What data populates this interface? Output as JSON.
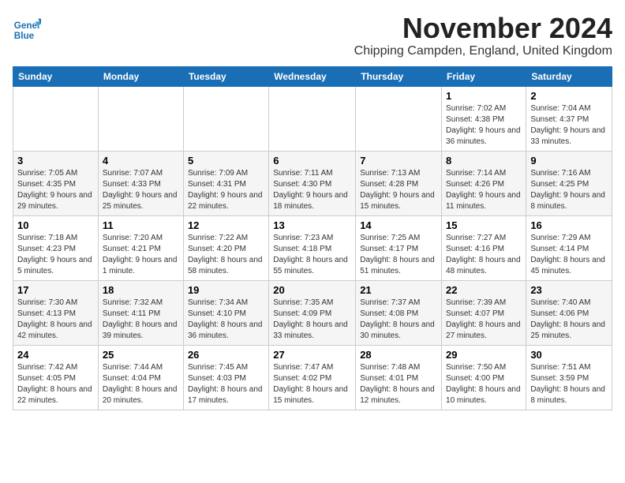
{
  "header": {
    "logo_line1": "General",
    "logo_line2": "Blue",
    "month_title": "November 2024",
    "location": "Chipping Campden, England, United Kingdom"
  },
  "weekdays": [
    "Sunday",
    "Monday",
    "Tuesday",
    "Wednesday",
    "Thursday",
    "Friday",
    "Saturday"
  ],
  "weeks": [
    [
      {
        "day": "",
        "info": ""
      },
      {
        "day": "",
        "info": ""
      },
      {
        "day": "",
        "info": ""
      },
      {
        "day": "",
        "info": ""
      },
      {
        "day": "",
        "info": ""
      },
      {
        "day": "1",
        "info": "Sunrise: 7:02 AM\nSunset: 4:38 PM\nDaylight: 9 hours and 36 minutes."
      },
      {
        "day": "2",
        "info": "Sunrise: 7:04 AM\nSunset: 4:37 PM\nDaylight: 9 hours and 33 minutes."
      }
    ],
    [
      {
        "day": "3",
        "info": "Sunrise: 7:05 AM\nSunset: 4:35 PM\nDaylight: 9 hours and 29 minutes."
      },
      {
        "day": "4",
        "info": "Sunrise: 7:07 AM\nSunset: 4:33 PM\nDaylight: 9 hours and 25 minutes."
      },
      {
        "day": "5",
        "info": "Sunrise: 7:09 AM\nSunset: 4:31 PM\nDaylight: 9 hours and 22 minutes."
      },
      {
        "day": "6",
        "info": "Sunrise: 7:11 AM\nSunset: 4:30 PM\nDaylight: 9 hours and 18 minutes."
      },
      {
        "day": "7",
        "info": "Sunrise: 7:13 AM\nSunset: 4:28 PM\nDaylight: 9 hours and 15 minutes."
      },
      {
        "day": "8",
        "info": "Sunrise: 7:14 AM\nSunset: 4:26 PM\nDaylight: 9 hours and 11 minutes."
      },
      {
        "day": "9",
        "info": "Sunrise: 7:16 AM\nSunset: 4:25 PM\nDaylight: 9 hours and 8 minutes."
      }
    ],
    [
      {
        "day": "10",
        "info": "Sunrise: 7:18 AM\nSunset: 4:23 PM\nDaylight: 9 hours and 5 minutes."
      },
      {
        "day": "11",
        "info": "Sunrise: 7:20 AM\nSunset: 4:21 PM\nDaylight: 9 hours and 1 minute."
      },
      {
        "day": "12",
        "info": "Sunrise: 7:22 AM\nSunset: 4:20 PM\nDaylight: 8 hours and 58 minutes."
      },
      {
        "day": "13",
        "info": "Sunrise: 7:23 AM\nSunset: 4:18 PM\nDaylight: 8 hours and 55 minutes."
      },
      {
        "day": "14",
        "info": "Sunrise: 7:25 AM\nSunset: 4:17 PM\nDaylight: 8 hours and 51 minutes."
      },
      {
        "day": "15",
        "info": "Sunrise: 7:27 AM\nSunset: 4:16 PM\nDaylight: 8 hours and 48 minutes."
      },
      {
        "day": "16",
        "info": "Sunrise: 7:29 AM\nSunset: 4:14 PM\nDaylight: 8 hours and 45 minutes."
      }
    ],
    [
      {
        "day": "17",
        "info": "Sunrise: 7:30 AM\nSunset: 4:13 PM\nDaylight: 8 hours and 42 minutes."
      },
      {
        "day": "18",
        "info": "Sunrise: 7:32 AM\nSunset: 4:11 PM\nDaylight: 8 hours and 39 minutes."
      },
      {
        "day": "19",
        "info": "Sunrise: 7:34 AM\nSunset: 4:10 PM\nDaylight: 8 hours and 36 minutes."
      },
      {
        "day": "20",
        "info": "Sunrise: 7:35 AM\nSunset: 4:09 PM\nDaylight: 8 hours and 33 minutes."
      },
      {
        "day": "21",
        "info": "Sunrise: 7:37 AM\nSunset: 4:08 PM\nDaylight: 8 hours and 30 minutes."
      },
      {
        "day": "22",
        "info": "Sunrise: 7:39 AM\nSunset: 4:07 PM\nDaylight: 8 hours and 27 minutes."
      },
      {
        "day": "23",
        "info": "Sunrise: 7:40 AM\nSunset: 4:06 PM\nDaylight: 8 hours and 25 minutes."
      }
    ],
    [
      {
        "day": "24",
        "info": "Sunrise: 7:42 AM\nSunset: 4:05 PM\nDaylight: 8 hours and 22 minutes."
      },
      {
        "day": "25",
        "info": "Sunrise: 7:44 AM\nSunset: 4:04 PM\nDaylight: 8 hours and 20 minutes."
      },
      {
        "day": "26",
        "info": "Sunrise: 7:45 AM\nSunset: 4:03 PM\nDaylight: 8 hours and 17 minutes."
      },
      {
        "day": "27",
        "info": "Sunrise: 7:47 AM\nSunset: 4:02 PM\nDaylight: 8 hours and 15 minutes."
      },
      {
        "day": "28",
        "info": "Sunrise: 7:48 AM\nSunset: 4:01 PM\nDaylight: 8 hours and 12 minutes."
      },
      {
        "day": "29",
        "info": "Sunrise: 7:50 AM\nSunset: 4:00 PM\nDaylight: 8 hours and 10 minutes."
      },
      {
        "day": "30",
        "info": "Sunrise: 7:51 AM\nSunset: 3:59 PM\nDaylight: 8 hours and 8 minutes."
      }
    ]
  ]
}
